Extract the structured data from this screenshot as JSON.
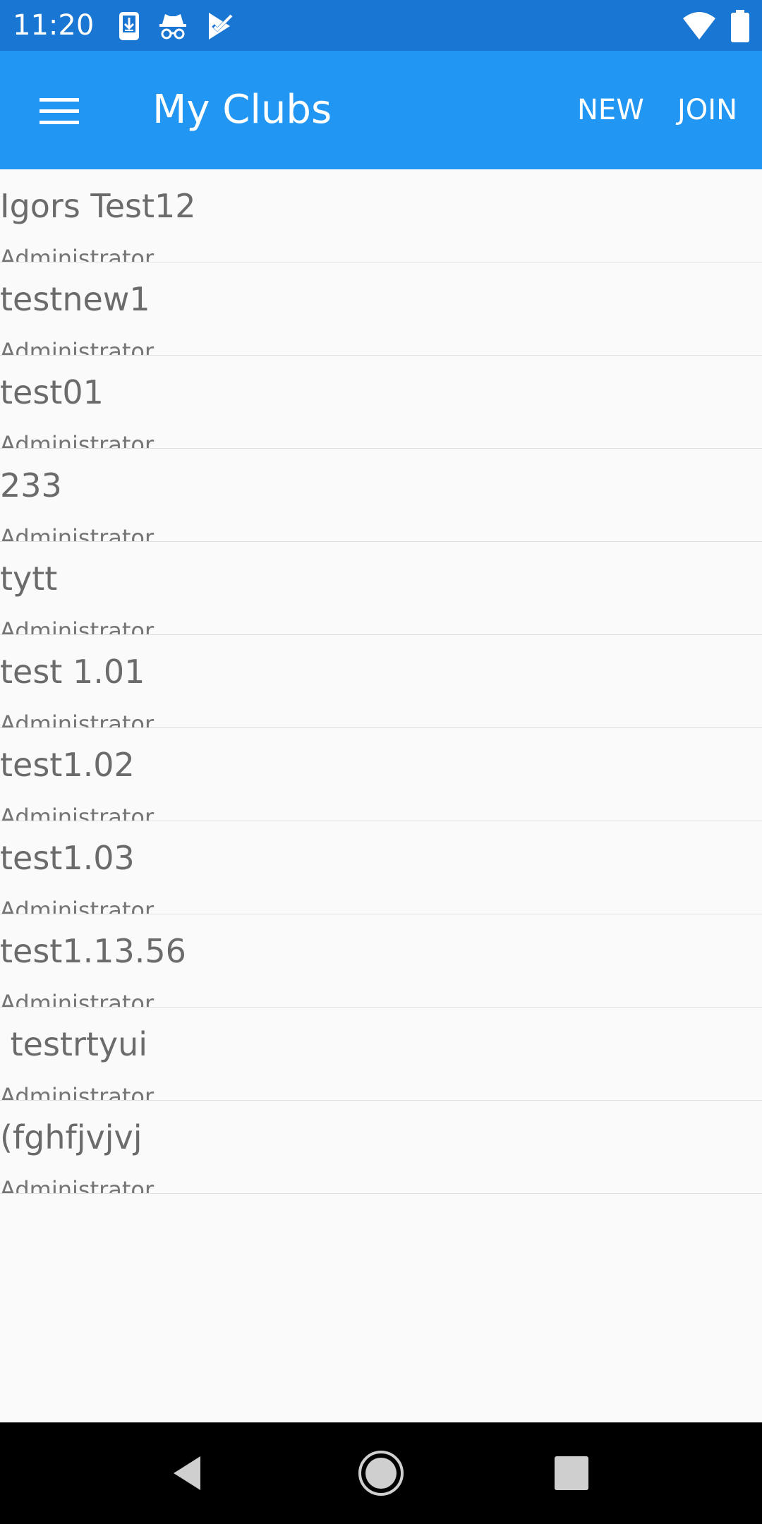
{
  "status_bar": {
    "time": "11:20",
    "icons": [
      "download-icon",
      "incognito-icon",
      "task-check-icon",
      "wifi-icon",
      "battery-icon"
    ]
  },
  "app_bar": {
    "title": "My Clubs",
    "actions": {
      "new": "NEW",
      "join": "JOIN"
    }
  },
  "clubs": [
    {
      "name": "Igors Test12",
      "role": "Administrator"
    },
    {
      "name": "testnew1",
      "role": "Administrator"
    },
    {
      "name": "test01",
      "role": "Administrator"
    },
    {
      "name": "233",
      "role": "Administrator"
    },
    {
      "name": "tytt",
      "role": "Administrator"
    },
    {
      "name": "test 1.01",
      "role": "Administrator"
    },
    {
      "name": "test1.02",
      "role": "Administrator"
    },
    {
      "name": "test1.03",
      "role": "Administrator"
    },
    {
      "name": "test1.13.56",
      "role": "Administrator"
    },
    {
      "name": " testrtyui",
      "role": "Administrator"
    },
    {
      "name": "(fghfjvjvj",
      "role": "Administrator"
    }
  ],
  "colors": {
    "status_bar": "#1976d2",
    "app_bar": "#2196f3",
    "background": "#fafafa"
  }
}
